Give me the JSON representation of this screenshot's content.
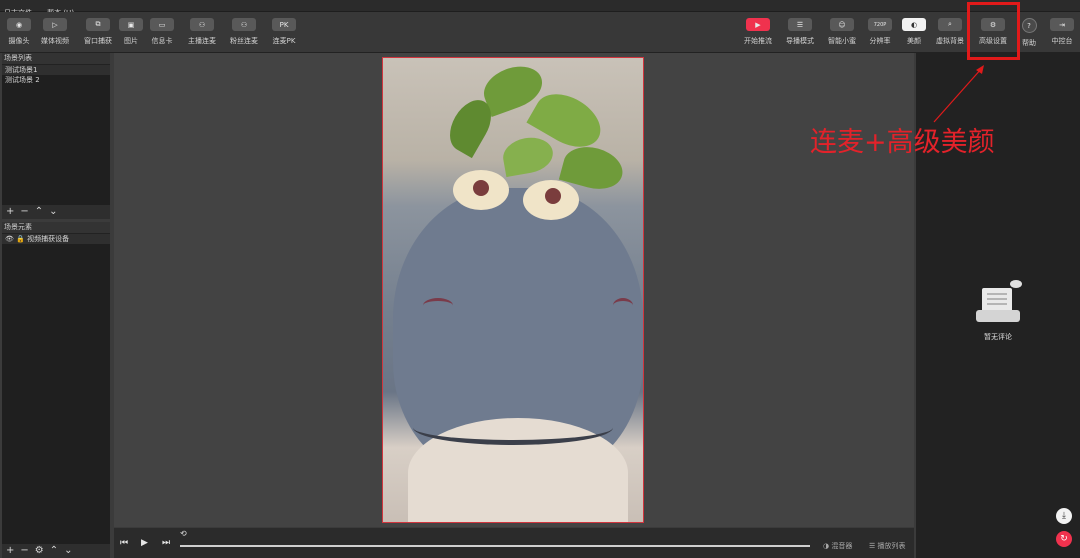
{
  "menu": [
    "日志文件",
    "帮本 (H)"
  ],
  "toolbar_left": [
    {
      "label": "摄像头",
      "icon": "camera-icon",
      "glyph": "◉"
    },
    {
      "label": "媒体视频",
      "icon": "play-icon",
      "glyph": "▷"
    },
    {
      "label": "窗口捕获",
      "icon": "window-icon",
      "glyph": "⧉"
    },
    {
      "label": "图片",
      "icon": "image-icon",
      "glyph": "▣"
    },
    {
      "label": "信息卡",
      "icon": "card-icon",
      "glyph": "▭"
    },
    {
      "label": "主播连麦",
      "icon": "host-link-icon",
      "glyph": "⚇"
    },
    {
      "label": "粉丝连麦",
      "icon": "fan-link-icon",
      "glyph": "⚇"
    },
    {
      "label": "连麦PK",
      "icon": "pk-icon",
      "glyph": "PK"
    }
  ],
  "toolbar_right": [
    {
      "label": "开始推流",
      "icon": "start-stream-icon",
      "glyph": "▶",
      "style": "red"
    },
    {
      "label": "导播模式",
      "icon": "director-mode-icon",
      "glyph": "☰",
      "style": ""
    },
    {
      "label": "智能小蜜",
      "icon": "smart-assistant-icon",
      "glyph": "☺",
      "style": ""
    },
    {
      "label": "分辨率",
      "icon": "resolution-icon",
      "glyph": "720P",
      "style": ""
    },
    {
      "label": "美颜",
      "icon": "beauty-icon",
      "glyph": "◐",
      "style": "white"
    },
    {
      "label": "虚拟背景",
      "icon": "virtual-bg-icon",
      "glyph": "⌕",
      "style": ""
    },
    {
      "label": "高级设置",
      "icon": "advanced-settings-icon",
      "glyph": "⚙",
      "style": ""
    },
    {
      "label": "帮助",
      "icon": "help-icon",
      "glyph": "?",
      "style": "round"
    },
    {
      "label": "中控台",
      "icon": "console-icon",
      "glyph": "⇥",
      "style": ""
    }
  ],
  "scene_panel": {
    "title": "场景列表",
    "items": [
      "测试场景1",
      "测试场景 2"
    ]
  },
  "element_panel": {
    "title": "场景元素",
    "items": [
      "视频捕获设备"
    ]
  },
  "transport": {
    "mixer": "混音器",
    "playlist": "播放列表"
  },
  "comments": {
    "empty": "暂无评论"
  },
  "annotation": {
    "text": "连麦+高级美颜"
  },
  "colors": {
    "accent": "#f0324e",
    "annotation": "#e11a1a"
  }
}
